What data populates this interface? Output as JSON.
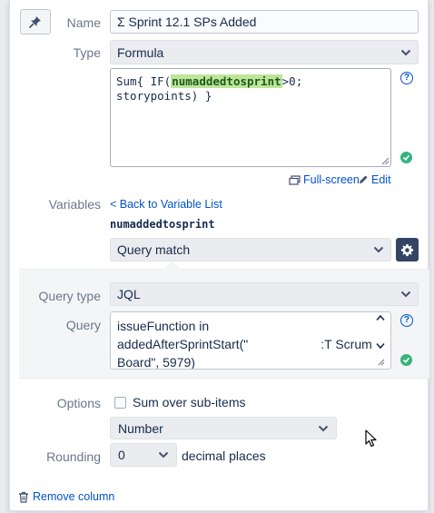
{
  "fields": {
    "name_label": "Name",
    "name_value": "Σ Sprint 12.1 SPs Added",
    "type_label": "Type",
    "type_value": "Formula",
    "formula_prefix": "Sum{ IF(",
    "formula_var": "numaddedtosprint",
    "formula_suffix": ">0; storypoints) }",
    "help_glyph": "?"
  },
  "formula_actions": {
    "fullscreen": "Full-screen",
    "edit": "Edit"
  },
  "variables": {
    "label": "Variables",
    "back_link": "< Back to Variable List",
    "var_name": "numaddedtosprint",
    "var_source": "Query match"
  },
  "query": {
    "type_label": "Query type",
    "type_value": "JQL",
    "query_label": "Query",
    "line1": "issueFunction in",
    "line2_start": "addedAfterSprintStart(\"",
    "line2_end": ":T Scrum",
    "line3": "Board\", 5979)"
  },
  "options": {
    "label": "Options",
    "sum_over_subitems": "Sum over sub-items",
    "format_value": "Number",
    "rounding_label": "Rounding",
    "rounding_value": "0",
    "decimal_places": "decimal places"
  },
  "footer": {
    "remove_column": "Remove column"
  },
  "colors": {
    "accent": "#0052cc",
    "success": "#36b37e",
    "highlight": "#bde699",
    "gear_bg": "#344563"
  }
}
